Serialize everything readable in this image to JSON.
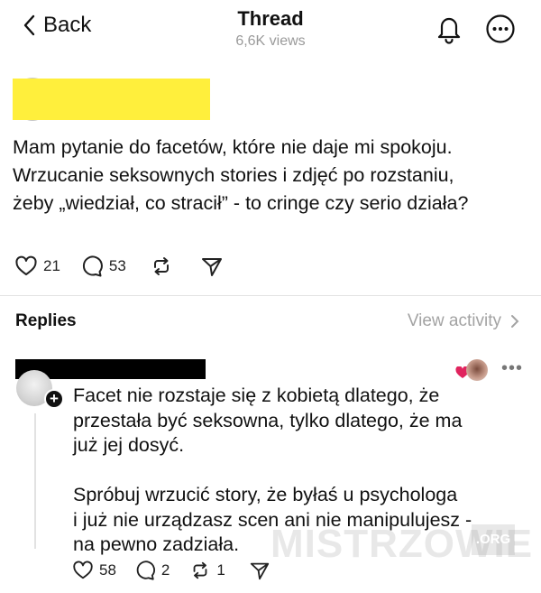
{
  "header": {
    "back_label": "Back",
    "title": "Thread",
    "views": "6,6K views"
  },
  "post": {
    "text": "Mam pytanie do facetów, które nie daje mi spokoju.\nWrzucanie seksownych stories i zdjęć po rozstaniu,\nżeby „wiedział, co stracił” - to cringe czy serio działa?",
    "likes": "21",
    "comments": "53"
  },
  "replies_section": {
    "label": "Replies",
    "view_activity": "View activity"
  },
  "reply": {
    "text": "Facet nie rozstaje się z kobietą dlatego, że\nprzestała być seksowna, tylko dlatego, że ma\njuż jej dosyć.\n\nSpróbuj wrzucić story, że byłaś u psychologa\ni już nie urządzasz scen ani nie manipulujesz -\nna pewno zadziała.",
    "likes": "58",
    "comments": "2",
    "reposts": "1"
  },
  "watermark": {
    "text": "MISTRZOWIE",
    "suffix": ".ORG"
  },
  "colors": {
    "redaction_yellow": "#ffef3c",
    "redaction_black": "#000000",
    "liked_heart": "#e0245e",
    "muted_text": "#9a9a9a"
  }
}
